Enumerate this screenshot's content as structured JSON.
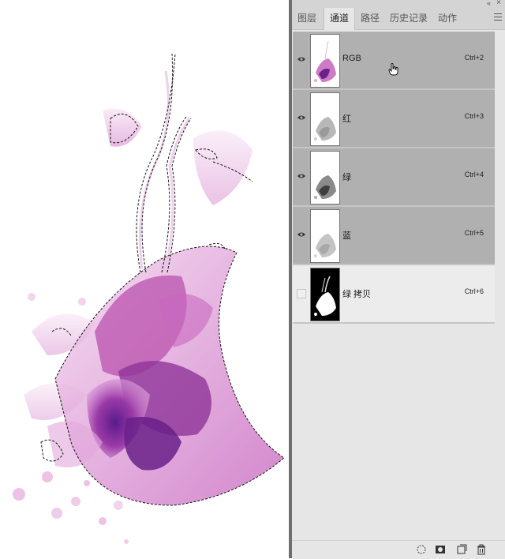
{
  "panel": {
    "collapse_glyph": "«",
    "close_glyph": "×",
    "tabs": [
      {
        "label": "图层",
        "active": false
      },
      {
        "label": "通道",
        "active": true
      },
      {
        "label": "路径",
        "active": false
      },
      {
        "label": "历史记录",
        "active": false
      },
      {
        "label": "动作",
        "active": false
      }
    ],
    "channels": [
      {
        "name": "RGB",
        "shortcut": "Ctrl+2",
        "visible": true,
        "selected": true,
        "thumb": "color"
      },
      {
        "name": "红",
        "shortcut": "Ctrl+3",
        "visible": true,
        "selected": true,
        "thumb": "gray-light"
      },
      {
        "name": "绿",
        "shortcut": "Ctrl+4",
        "visible": true,
        "selected": true,
        "thumb": "gray-dark"
      },
      {
        "name": "蓝",
        "shortcut": "Ctrl+5",
        "visible": true,
        "selected": true,
        "thumb": "gray-light"
      },
      {
        "name": "绿 拷贝",
        "shortcut": "Ctrl+6",
        "visible": false,
        "selected": false,
        "thumb": "mask"
      }
    ],
    "bottom_icons": [
      "load-channel-as-selection-icon",
      "save-selection-as-channel-icon",
      "new-channel-icon",
      "delete-channel-icon"
    ]
  },
  "colors": {
    "accent_purple": "#8a2c9c",
    "petal_pink": "#d98fcf",
    "panel_bg": "#e6e6e6",
    "selected_row": "#b0b0b0"
  }
}
